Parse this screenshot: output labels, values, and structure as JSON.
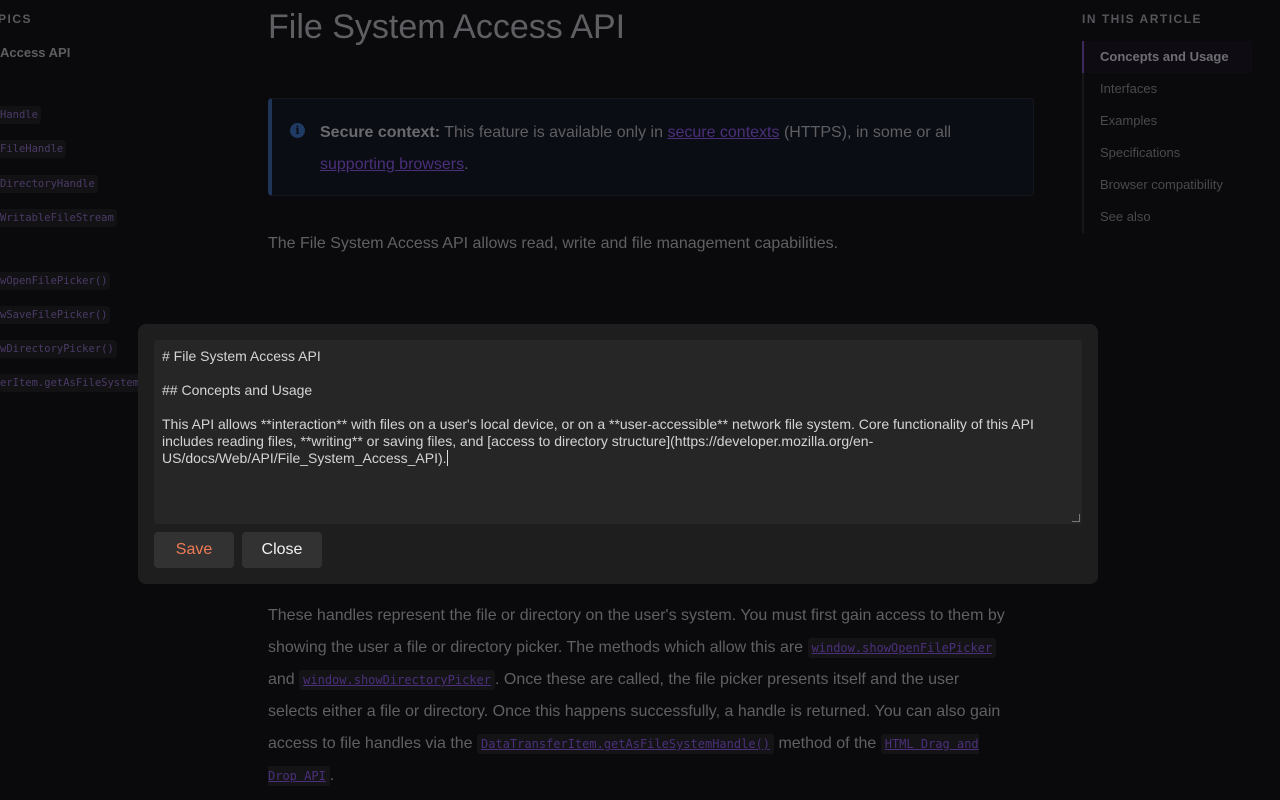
{
  "sidebar": {
    "heading": "PICS",
    "title": "Access API",
    "interfaces": [
      "Handle",
      "FileHandle",
      "DirectoryHandle",
      "WritableFileStream"
    ],
    "methods": [
      "wOpenFilePicker()",
      "wSaveFilePicker()",
      "wDirectoryPicker()",
      "erItem.getAsFileSystemHandle()"
    ]
  },
  "main": {
    "title": "File System Access API",
    "note": {
      "icon": "info-icon",
      "label": "Secure context:",
      "text1": " This feature is available only in ",
      "link1": "secure contexts",
      "text2": " (HTTPS), in some or all ",
      "link2": "supporting browsers",
      "text3": "."
    },
    "intro": "The File System Access API allows read, write and file management capabilities.",
    "para": {
      "t1": "These handles represent the file or directory on the user's system. You must first gain access to them by showing the user a file or directory picker. The methods which allow this are ",
      "c1": "window.showOpenFilePicker",
      "t2": " and ",
      "c2": "window.showDirectoryPicker",
      "t3": ". Once these are called, the file picker presents itself and the user selects either a file or directory. Once this happens successfully, a handle is returned. You can also gain access to file handles via the ",
      "c3": "DataTransferItem.getAsFileSystemHandle()",
      "t4": " method of the ",
      "c4": "HTML Drag and Drop API",
      "t5": "."
    }
  },
  "toc": {
    "heading": "IN THIS ARTICLE",
    "items": [
      "Concepts and Usage",
      "Interfaces",
      "Examples",
      "Specifications",
      "Browser compatibility",
      "See also"
    ]
  },
  "modal": {
    "content": "# File System Access API\n\n## Concepts and Usage\n\nThis API allows **interaction** with files on a user's local device, or on a **user-accessible** network file system. Core functionality of this API includes reading files, **writing** or saving files, and [access to directory structure](https://developer.mozilla.org/en-US/docs/Web/API/File_System_Access_API).",
    "save": "Save",
    "close": "Close",
    "save_color": "#f07a55"
  }
}
